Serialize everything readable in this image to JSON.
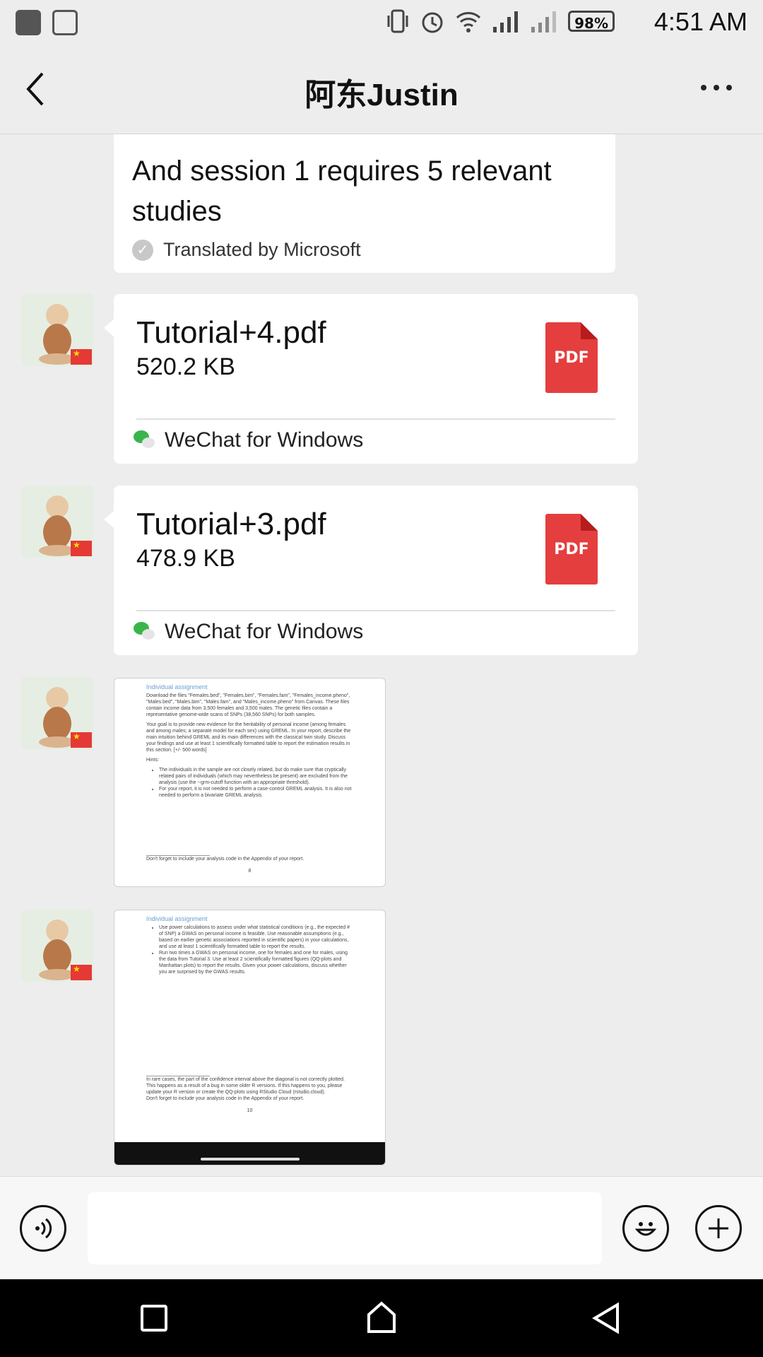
{
  "status_bar": {
    "battery": "98%",
    "time": "4:51 AM"
  },
  "header": {
    "title": "阿东Justin"
  },
  "messages": {
    "text_message": {
      "text": "And session 1 requires 5 relevant studies",
      "translation_note": "Translated by Microsoft"
    },
    "files": [
      {
        "name": "Tutorial+4.pdf",
        "size": "520.2 KB",
        "icon_label": "PDF",
        "source": "WeChat for Windows"
      },
      {
        "name": "Tutorial+3.pdf",
        "size": "478.9 KB",
        "icon_label": "PDF",
        "source": "WeChat for Windows"
      }
    ],
    "images": [
      {
        "heading": "Individual assignment",
        "para1": "Download the files \"Females.bed\", \"Females.bim\", \"Females.fam\", \"Females_income.pheno\", \"Males.bed\", \"Males.bim\", \"Males.fam\", and \"Males_income.pheno\" from Canvas. These files contain income data from 3,500 females and 3,500 males. The genetic files contain a representative genome-wide scans of SNPs (38,560 SNPs) for both samples.",
        "para2": "Your goal is to provide new evidence for the heritability of personal income (among females and among males; a separate model for each sex) using GREML. In your report, describe the main intuition behind GREML and its main differences with the classical twin study. Discuss your findings and use at least 1 scientifically formatted table to report the estimation results in this section. [+/- 500 words]",
        "hints": "Hints:",
        "bullet1": "The individuals in the sample are not closely related, but do make sure that cryptically related pairs of individuals (which may nevertheless be present) are excluded from the analysis (use the --grm-cutoff function with an appropriate threshold).",
        "bullet2": "For your report, it is not needed to perform a case-control GREML analysis. It is also not needed to perform a bivariate GREML analysis.",
        "footnote": "Don't forget to include your analysis code in the Appendix of your report.",
        "page": "8"
      },
      {
        "heading": "Individual assignment",
        "bullet1": "Use power calculations to assess under what statistical conditions (e.g., the expected # of SNP) a GWAS on personal income is feasible. Use reasonable assumptions (e.g., based on earlier genetic associations reported in scientific papers) in your calculations, and use at least 1 scientifically formatted table to report the results.",
        "bullet2": "Run two times a GWAS on personal income, one for females and one for males, using the data from Tutorial 3. Use at least 2 scientifically formatted figures (QQ-plots and Manhattan plots) to report the results. Given your power calculations, discuss whether you are surprised by the GWAS results.",
        "footnote1": "In rare cases, the part of the confidence interval above the diagonal is not correctly plotted. This happens as a result of a bug in some older R versions. If this happens to you, please update your R version or create the QQ-plots using RStudio Cloud (rstudio.cloud).",
        "footnote2": "Don't forget to include your analysis code in the Appendix of your report.",
        "page": "10"
      }
    ]
  },
  "icons": {
    "voice": "voice-icon",
    "emoji": "emoji-icon",
    "plus": "plus-icon"
  }
}
